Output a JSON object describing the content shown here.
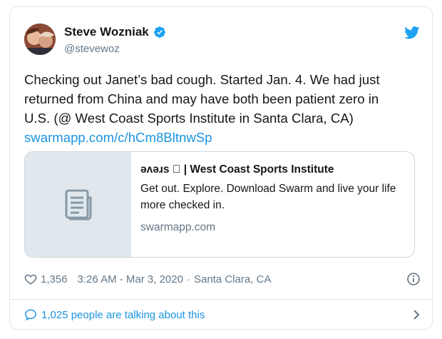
{
  "tweet": {
    "author": {
      "display_name": "Steve Wozniak",
      "handle": "@stevewoz",
      "verified": true
    },
    "text_lines": [
      "Checking out Janet’s bad cough. Started Jan. 4. We had just",
      "returned from China and may have both been patient zero in",
      "U.S. (@ West Coast Sports Institute in Santa Clara, CA)"
    ],
    "link_text": "swarmapp.com/c/hCm8BltnwSp",
    "card": {
      "title": "əʌəɹs  | West Coast Sports Institute",
      "description": "Get out. Explore. Download Swarm and live your life more checked in.",
      "domain": "swarmapp.com"
    },
    "likes": "1,356",
    "timestamp": "3:26 AM - Mar 3, 2020",
    "separator": "·",
    "location": "Santa Clara, CA",
    "talking": "1,025 people are talking about this"
  },
  "colors": {
    "accent": "#1b95e0",
    "verified": "#1da1f2",
    "muted": "#657786",
    "border": "#e1e8ed"
  },
  "icons": {
    "verified": "verified-badge-icon",
    "brand": "twitter-bird-icon",
    "card_thumbnail": "document-icon",
    "like": "heart-icon",
    "info": "info-icon",
    "replies": "speech-bubble-icon",
    "more": "chevron-right-icon"
  }
}
